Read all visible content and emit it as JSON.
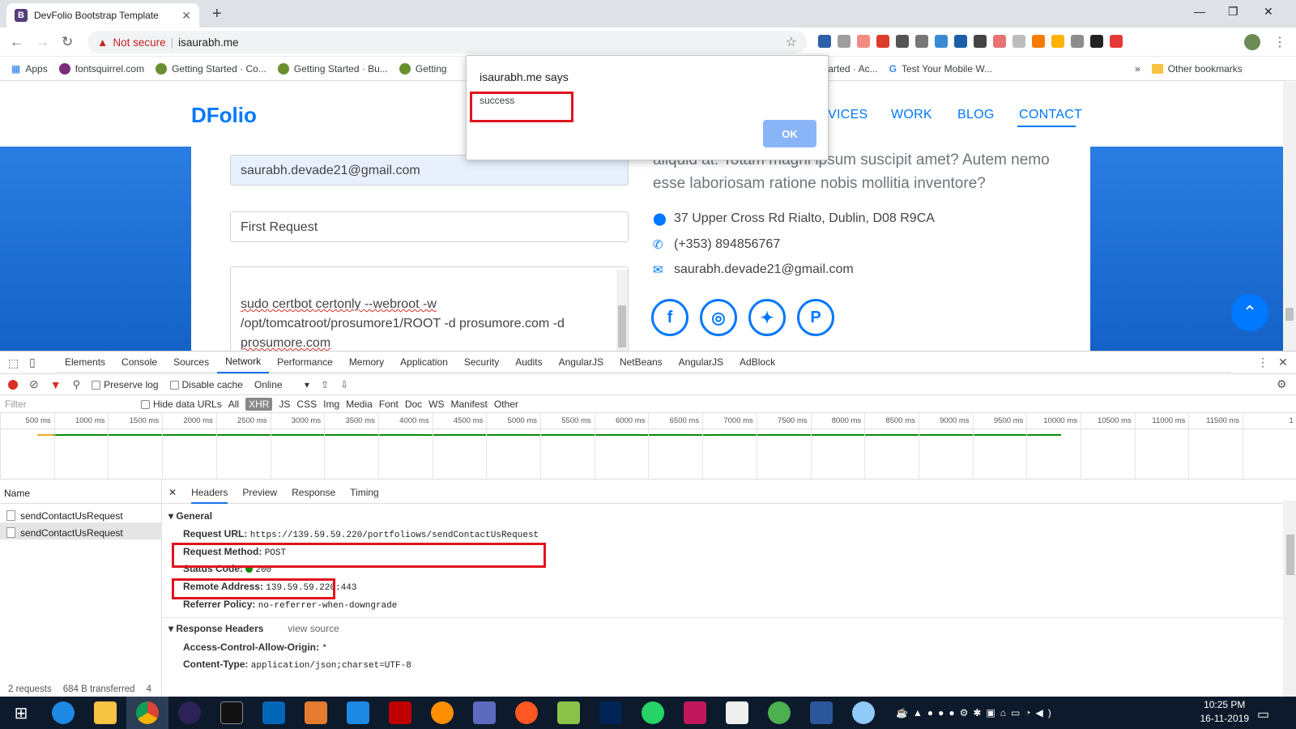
{
  "browser": {
    "tab_title": "DevFolio Bootstrap Template",
    "new_tab": "+",
    "not_secure": "Not secure",
    "url": "isaurabh.me",
    "bookmarks": [
      "Apps",
      "fontsquirrel.com",
      "Getting Started · Co...",
      "Getting Started · Bu...",
      "Getting",
      "ing Started · Ac...",
      "Test Your Mobile W...",
      "Other bookmarks"
    ]
  },
  "site": {
    "brand": "DFolio",
    "nav": [
      "VICES",
      "WORK",
      "BLOG",
      "CONTACT"
    ],
    "email_value": "saurabh.devade21@gmail.com",
    "subject_value": "First Request",
    "message_lines": [
      "sudo certbot certonly --webroot -w",
      "/opt/tomcatroot/prosumore1/ROOT -d prosumore.com -d",
      "prosumore.com"
    ],
    "text_lines": [
      "aliquid at. Totam magni ipsum suscipit amet? Autem nemo",
      "esse laboriosam ratione nobis mollitia inventore?"
    ],
    "address": "37 Upper Cross Rd Rialto, Dublin, D08 R9CA",
    "phone": "(+353) 894856767",
    "email": "saurabh.devade21@gmail.com",
    "social": [
      "facebook-icon",
      "instagram-icon",
      "twitter-icon",
      "pinterest-icon"
    ]
  },
  "alert": {
    "title": "isaurabh.me says",
    "message": "success",
    "ok": "OK"
  },
  "devtools": {
    "tabs": [
      "Elements",
      "Console",
      "Sources",
      "Network",
      "Performance",
      "Memory",
      "Application",
      "Security",
      "Audits",
      "AngularJS",
      "NetBeans",
      "AngularJS",
      "AdBlock"
    ],
    "active_tab": "Network",
    "preserve_log": "Preserve log",
    "disable_cache": "Disable cache",
    "throttle": "Online",
    "filter_placeholder": "Filter",
    "hide_data_urls": "Hide data URLs",
    "type_filters": [
      "All",
      "XHR",
      "JS",
      "CSS",
      "Img",
      "Media",
      "Font",
      "Doc",
      "WS",
      "Manifest",
      "Other"
    ],
    "timeline_ticks": [
      "500 ms",
      "1000 ms",
      "1500 ms",
      "2000 ms",
      "2500 ms",
      "3000 ms",
      "3500 ms",
      "4000 ms",
      "4500 ms",
      "5000 ms",
      "5500 ms",
      "6000 ms",
      "6500 ms",
      "7000 ms",
      "7500 ms",
      "8000 ms",
      "8500 ms",
      "9000 ms",
      "9500 ms",
      "10000 ms",
      "10500 ms",
      "11000 ms",
      "11500 ms",
      "1"
    ],
    "name_header": "Name",
    "requests": [
      "sendContactUsRequest",
      "sendContactUsRequest"
    ],
    "status_requests": "2 requests",
    "status_transferred": "684 B transferred",
    "status_extra": "4",
    "detail_tabs": [
      "Headers",
      "Preview",
      "Response",
      "Timing"
    ],
    "general_title": "General",
    "request_url_label": "Request URL:",
    "request_url": "https://139.59.59.220/portfoliows/sendContactUsRequest",
    "request_method_label": "Request Method:",
    "request_method": "POST",
    "status_code_label": "Status Code:",
    "status_code": "200",
    "remote_address_label": "Remote Address:",
    "remote_address": "139.59.59.220:443",
    "referrer_label": "Referrer Policy:",
    "referrer": "no-referrer-when-downgrade",
    "response_headers_title": "Response Headers",
    "view_source": "view source",
    "acao_label": "Access-Control-Allow-Origin:",
    "acao": "*",
    "content_type_label": "Content-Type:",
    "content_type": "application/json;charset=UTF-8"
  },
  "taskbar": {
    "time": "10:25 PM",
    "date": "16-11-2019"
  },
  "colors": {
    "accent": "#0078ff",
    "highlight": "#e0141e",
    "devtools_active": "#1a73e8"
  }
}
